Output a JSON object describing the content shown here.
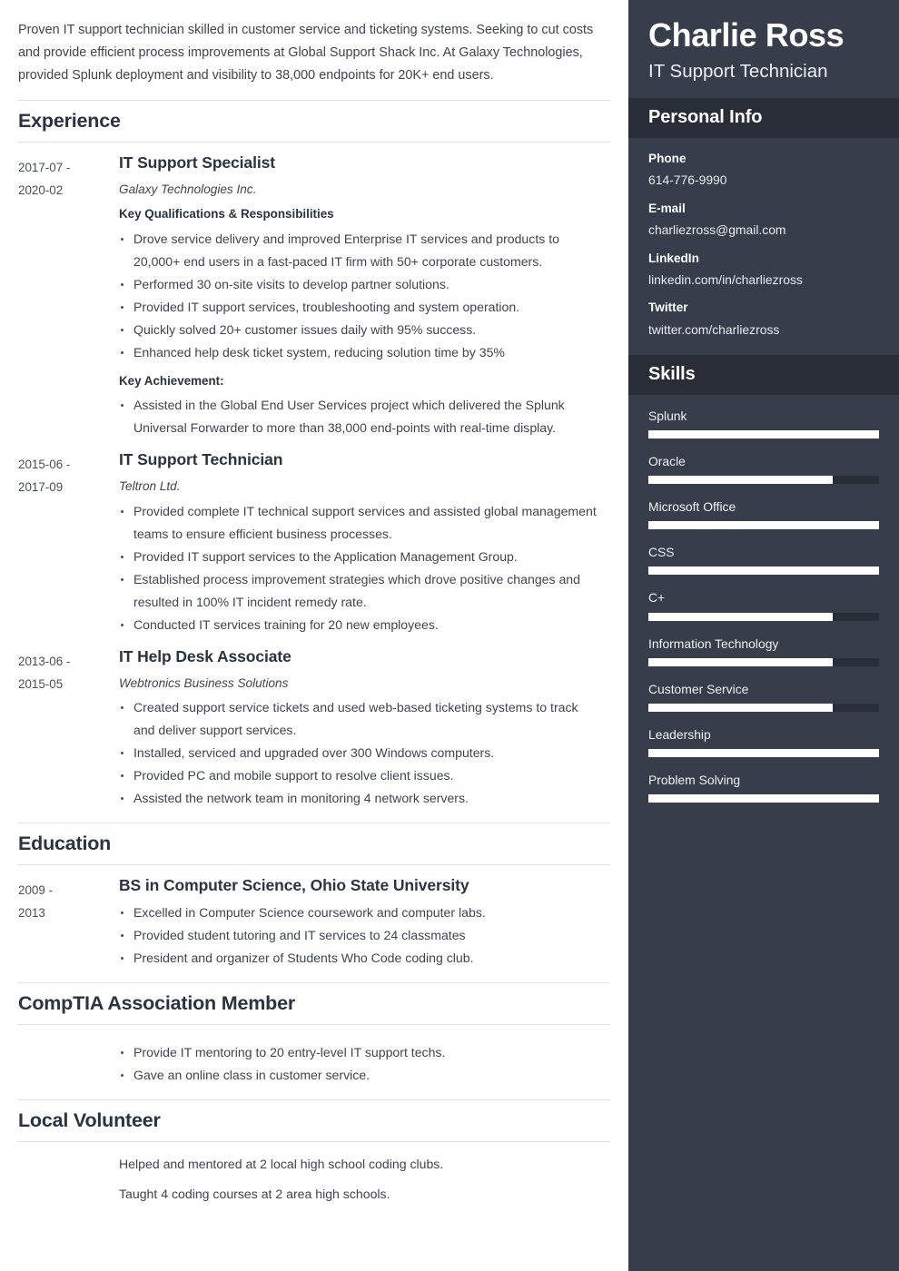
{
  "summary": "Proven IT support technician skilled in customer service and ticketing systems. Seeking to cut costs and provide efficient process improvements at Global Support Shack Inc. At Galaxy Technologies, provided Splunk deployment and visibility to 38,000 endpoints for 20K+ end users.",
  "sections": {
    "experience": {
      "title": "Experience",
      "entries": [
        {
          "dates": "2017-07 - 2020-02",
          "title": "IT Support Specialist",
          "org": "Galaxy Technologies Inc.",
          "subhead": "Key Qualifications & Responsibilities",
          "bullets": [
            "Drove service delivery and improved Enterprise IT services and products to 20,000+ end users in a fast-paced IT firm with 50+ corporate customers.",
            "Performed 30 on-site visits to develop partner solutions.",
            "Provided IT support services, troubleshooting and system operation.",
            "Quickly solved 20+ customer issues daily with 95% success.",
            "Enhanced help desk ticket system, reducing solution time by 35%"
          ],
          "subhead2": "Key Achievement:",
          "bullets2": [
            "Assisted in the Global End User Services project which delivered the Splunk Universal Forwarder to more than 38,000 end-points with real-time display."
          ]
        },
        {
          "dates": "2015-06 - 2017-09",
          "title": "IT Support Technician",
          "org": "Teltron Ltd.",
          "bullets": [
            "Provided complete IT technical support services and assisted global management teams to ensure efficient business processes.",
            "Provided IT support services to the Application Management Group.",
            "Established process improvement strategies which drove positive changes and resulted in 100% IT incident remedy rate.",
            "Conducted IT services training for 20 new employees."
          ]
        },
        {
          "dates": "2013-06 - 2015-05",
          "title": "IT Help Desk Associate",
          "org": "Webtronics Business Solutions",
          "bullets": [
            "Created support service tickets and used web-based ticketing systems to track and deliver support services.",
            "Installed, serviced and upgraded over 300 Windows computers.",
            "Provided PC and mobile support to resolve client issues.",
            "Assisted the network team in monitoring 4 network servers."
          ]
        }
      ]
    },
    "education": {
      "title": "Education",
      "entries": [
        {
          "dates": "2009 - 2013",
          "title": "BS in Computer Science, Ohio State University",
          "bullets": [
            "Excelled in Computer Science coursework and computer labs.",
            "Provided student tutoring and IT services to 24 classmates",
            "President and organizer of Students Who Code coding club."
          ]
        }
      ]
    },
    "comptia": {
      "title": "CompTIA Association Member",
      "bullets": [
        "Provide IT mentoring to 20 entry-level IT support techs.",
        "Gave an online class in customer service."
      ]
    },
    "volunteer": {
      "title": "Local Volunteer",
      "lines": [
        "Helped and mentored at 2 local high school coding clubs.",
        "Taught 4 coding courses at 2 area high schools."
      ]
    }
  },
  "sidebar": {
    "name": "Charlie Ross",
    "role": "IT Support Technician",
    "personal_info": {
      "heading": "Personal Info",
      "items": [
        {
          "label": "Phone",
          "value": "614-776-9990"
        },
        {
          "label": "E-mail",
          "value": "charliezross@gmail.com"
        },
        {
          "label": "LinkedIn",
          "value": "linkedin.com/in/charliezross"
        },
        {
          "label": "Twitter",
          "value": "twitter.com/charliezross"
        }
      ]
    },
    "skills": {
      "heading": "Skills",
      "items": [
        {
          "name": "Splunk",
          "level": 100
        },
        {
          "name": "Oracle",
          "level": 80
        },
        {
          "name": "Microsoft Office",
          "level": 100
        },
        {
          "name": "CSS",
          "level": 100
        },
        {
          "name": "C+",
          "level": 80
        },
        {
          "name": "Information Technology",
          "level": 80
        },
        {
          "name": "Customer Service",
          "level": 80
        },
        {
          "name": "Leadership",
          "level": 100
        },
        {
          "name": "Problem Solving",
          "level": 100
        }
      ]
    }
  },
  "colors": {
    "sidebar_bg": "#373d4b",
    "sidebar_band": "#282d38",
    "heading": "#2b3241",
    "body_text": "#3f4450",
    "rule": "#e2e3e6",
    "skill_fill": "#ffffff"
  }
}
